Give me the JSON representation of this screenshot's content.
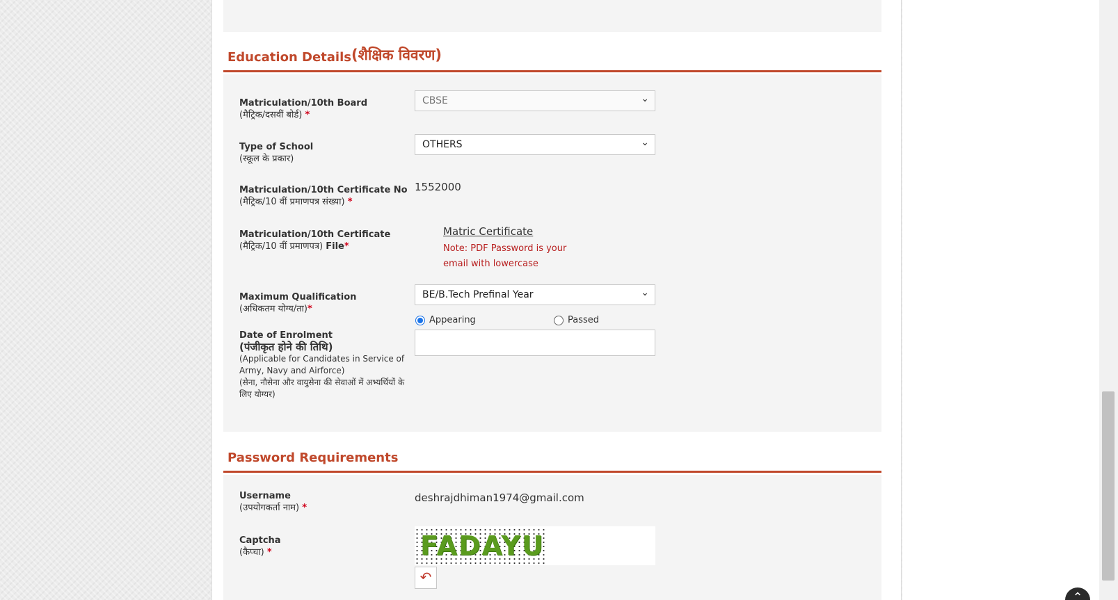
{
  "education": {
    "title_en": "Education Details",
    "title_hi": "(शैक्षिक विवरण)",
    "fields": {
      "board": {
        "label_en": "Matriculation/10th Board",
        "label_hi": "(मैट्रिक/दसवीं बोर्ड)",
        "required": "*",
        "value": "CBSE"
      },
      "school_type": {
        "label_en": "Type of School",
        "label_hi": "(स्कूल के प्रकार)",
        "value": "OTHERS"
      },
      "cert_no": {
        "label_en": "Matriculation/10th Certificate No",
        "label_hi": "(मैट्रिक/10 वीं प्रमाणपत्र संख्या)",
        "required": "*",
        "value": "1552000"
      },
      "cert_file": {
        "label_en": "Matriculation/10th Certificate",
        "label_hi": "(मैट्रिक/10 वीं प्रमाणपत्र)",
        "label_suffix": "File",
        "required": "*",
        "link": "Matric Certificate",
        "note": "Note: PDF Password is your email with lowercase"
      },
      "qualification": {
        "label_en": "Maximum Qualification",
        "label_hi": "(अधिकतम योग्य/ता)",
        "required": "*",
        "value": "BE/B.Tech Prefinal Year",
        "options": [
          "Appearing",
          "Passed"
        ],
        "selected": "Appearing"
      },
      "enrolment": {
        "label_en": "Date of Enrolment",
        "label_hi": "(पंजीकृत होने की तिथि)",
        "note_en": "(Applicable for Candidates in Service of Army, Navy and Airforce)",
        "note_hi": "(सेना, नौसेना और वायुसेना की सेवाओं में अभ्यर्थियों के लिए योग्यर)",
        "value": ""
      }
    }
  },
  "password": {
    "title": "Password Requirements",
    "username": {
      "label_en": "Username",
      "label_hi": "(उपयोगकर्ता नाम)",
      "required": "*",
      "value": "deshrajdhiman1974@gmail.com"
    },
    "captcha": {
      "label_en": "Captcha",
      "label_hi": "(कैप्चा)",
      "required": "*",
      "text": "FADAYU"
    }
  },
  "icons": {
    "chevron": "chevron-down-icon",
    "refresh": "refresh-icon",
    "scroll_top": "arrow-up-icon"
  },
  "colors": {
    "accent": "#c0482b",
    "required": "#d0021b",
    "note": "#b81f1f",
    "captcha": "#5a9b1e"
  }
}
